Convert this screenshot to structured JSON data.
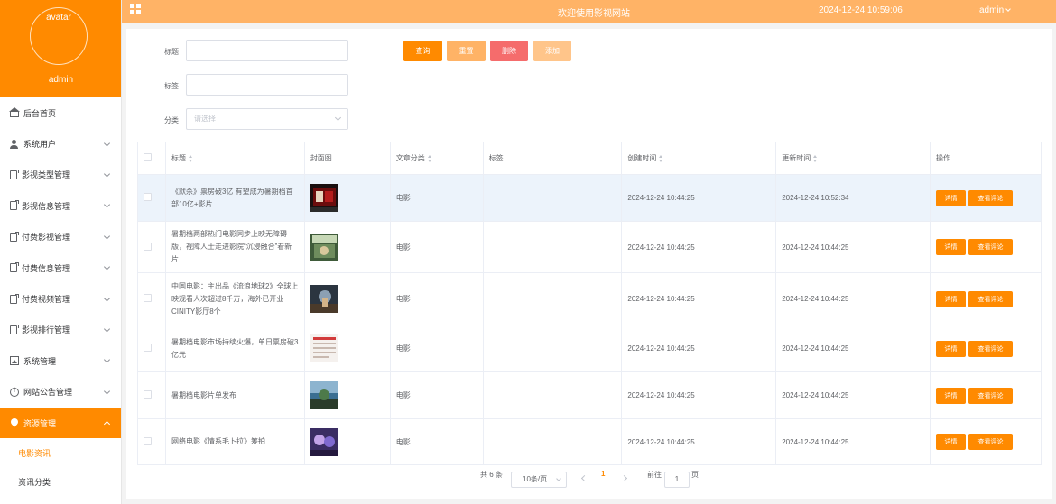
{
  "sidebar": {
    "avatar_text": "avatar",
    "username": "admin",
    "menu": [
      {
        "label": "后台首页",
        "icon": "home-icon",
        "has_arrow": false
      },
      {
        "label": "系统用户",
        "icon": "user-icon",
        "has_arrow": true
      },
      {
        "label": "影视类型管理",
        "icon": "document-icon",
        "has_arrow": true
      },
      {
        "label": "影视信息管理",
        "icon": "document-icon",
        "has_arrow": true
      },
      {
        "label": "付费影视管理",
        "icon": "document-icon",
        "has_arrow": true
      },
      {
        "label": "付费信息管理",
        "icon": "document-icon",
        "has_arrow": true
      },
      {
        "label": "付费视频管理",
        "icon": "document-icon",
        "has_arrow": true
      },
      {
        "label": "影视排行管理",
        "icon": "document-icon",
        "has_arrow": true
      },
      {
        "label": "系统管理",
        "icon": "image-icon",
        "has_arrow": true
      },
      {
        "label": "网站公告管理",
        "icon": "info-icon",
        "has_arrow": true
      },
      {
        "label": "资源管理",
        "icon": "location-pin-icon",
        "has_arrow": true,
        "active": true
      }
    ],
    "submenu": [
      {
        "label": "电影资讯",
        "current": true
      },
      {
        "label": "资讯分类",
        "current": false
      }
    ]
  },
  "topbar": {
    "site_title": "欢迎使用影视网站",
    "datetime": "2024-12-24 10:59:06",
    "user": "admin"
  },
  "search": {
    "title_label": "标题",
    "tag_label": "标签",
    "category_label": "分类",
    "category_placeholder": "请选择",
    "buttons": {
      "query": "查询",
      "reset": "重置",
      "delete": "删除",
      "add": "添加"
    }
  },
  "table": {
    "headers": {
      "title": "标题",
      "cover": "封面图",
      "category": "文章分类",
      "tags": "标签",
      "created": "创建时间",
      "updated": "更新时间",
      "actions": "操作"
    },
    "rows": [
      {
        "title": "《默杀》票房破3亿 有望成为暑期档首部10亿+影片",
        "category": "电影",
        "tags": "",
        "created": "2024-12-24 10:44:25",
        "updated": "2024-12-24 10:52:34",
        "detail": "详情",
        "comment": "查看评论"
      },
      {
        "title": "暑期档两部热门电影同步上映无障碍版，视障人士走进影院“沉浸融合”看新片",
        "category": "电影",
        "tags": "",
        "created": "2024-12-24 10:44:25",
        "updated": "2024-12-24 10:44:25",
        "detail": "详情",
        "comment": "查看评论"
      },
      {
        "title": "中国电影：主出品《流浪地球2》全球上映观看人次超过8千万，海外已开业CINITY影厅8个",
        "category": "电影",
        "tags": "",
        "created": "2024-12-24 10:44:25",
        "updated": "2024-12-24 10:44:25",
        "detail": "详情",
        "comment": "查看评论"
      },
      {
        "title": "暑期档电影市场持续火爆，单日票房破3亿元",
        "category": "电影",
        "tags": "",
        "created": "2024-12-24 10:44:25",
        "updated": "2024-12-24 10:44:25",
        "detail": "详情",
        "comment": "查看评论"
      },
      {
        "title": "暑期档电影片单发布",
        "category": "电影",
        "tags": "",
        "created": "2024-12-24 10:44:25",
        "updated": "2024-12-24 10:44:25",
        "detail": "详情",
        "comment": "查看评论"
      },
      {
        "title": "网络电影《情系毛卜拉》筹拍",
        "category": "电影",
        "tags": "",
        "created": "2024-12-24 10:44:25",
        "updated": "2024-12-24 10:44:25",
        "detail": "详情",
        "comment": "查看评论"
      }
    ]
  },
  "pagination": {
    "total": "共 6 条",
    "page_size": "10条/页",
    "current_page": "1",
    "goto_label": "前往",
    "goto_value": "1",
    "page_suffix": "页"
  },
  "colors": {
    "accent": "#ff8a00",
    "topbar": "#ffb366",
    "reset_button": "#ffb366",
    "delete_button": "#f56c6c",
    "add_button": "#ffc58a"
  }
}
